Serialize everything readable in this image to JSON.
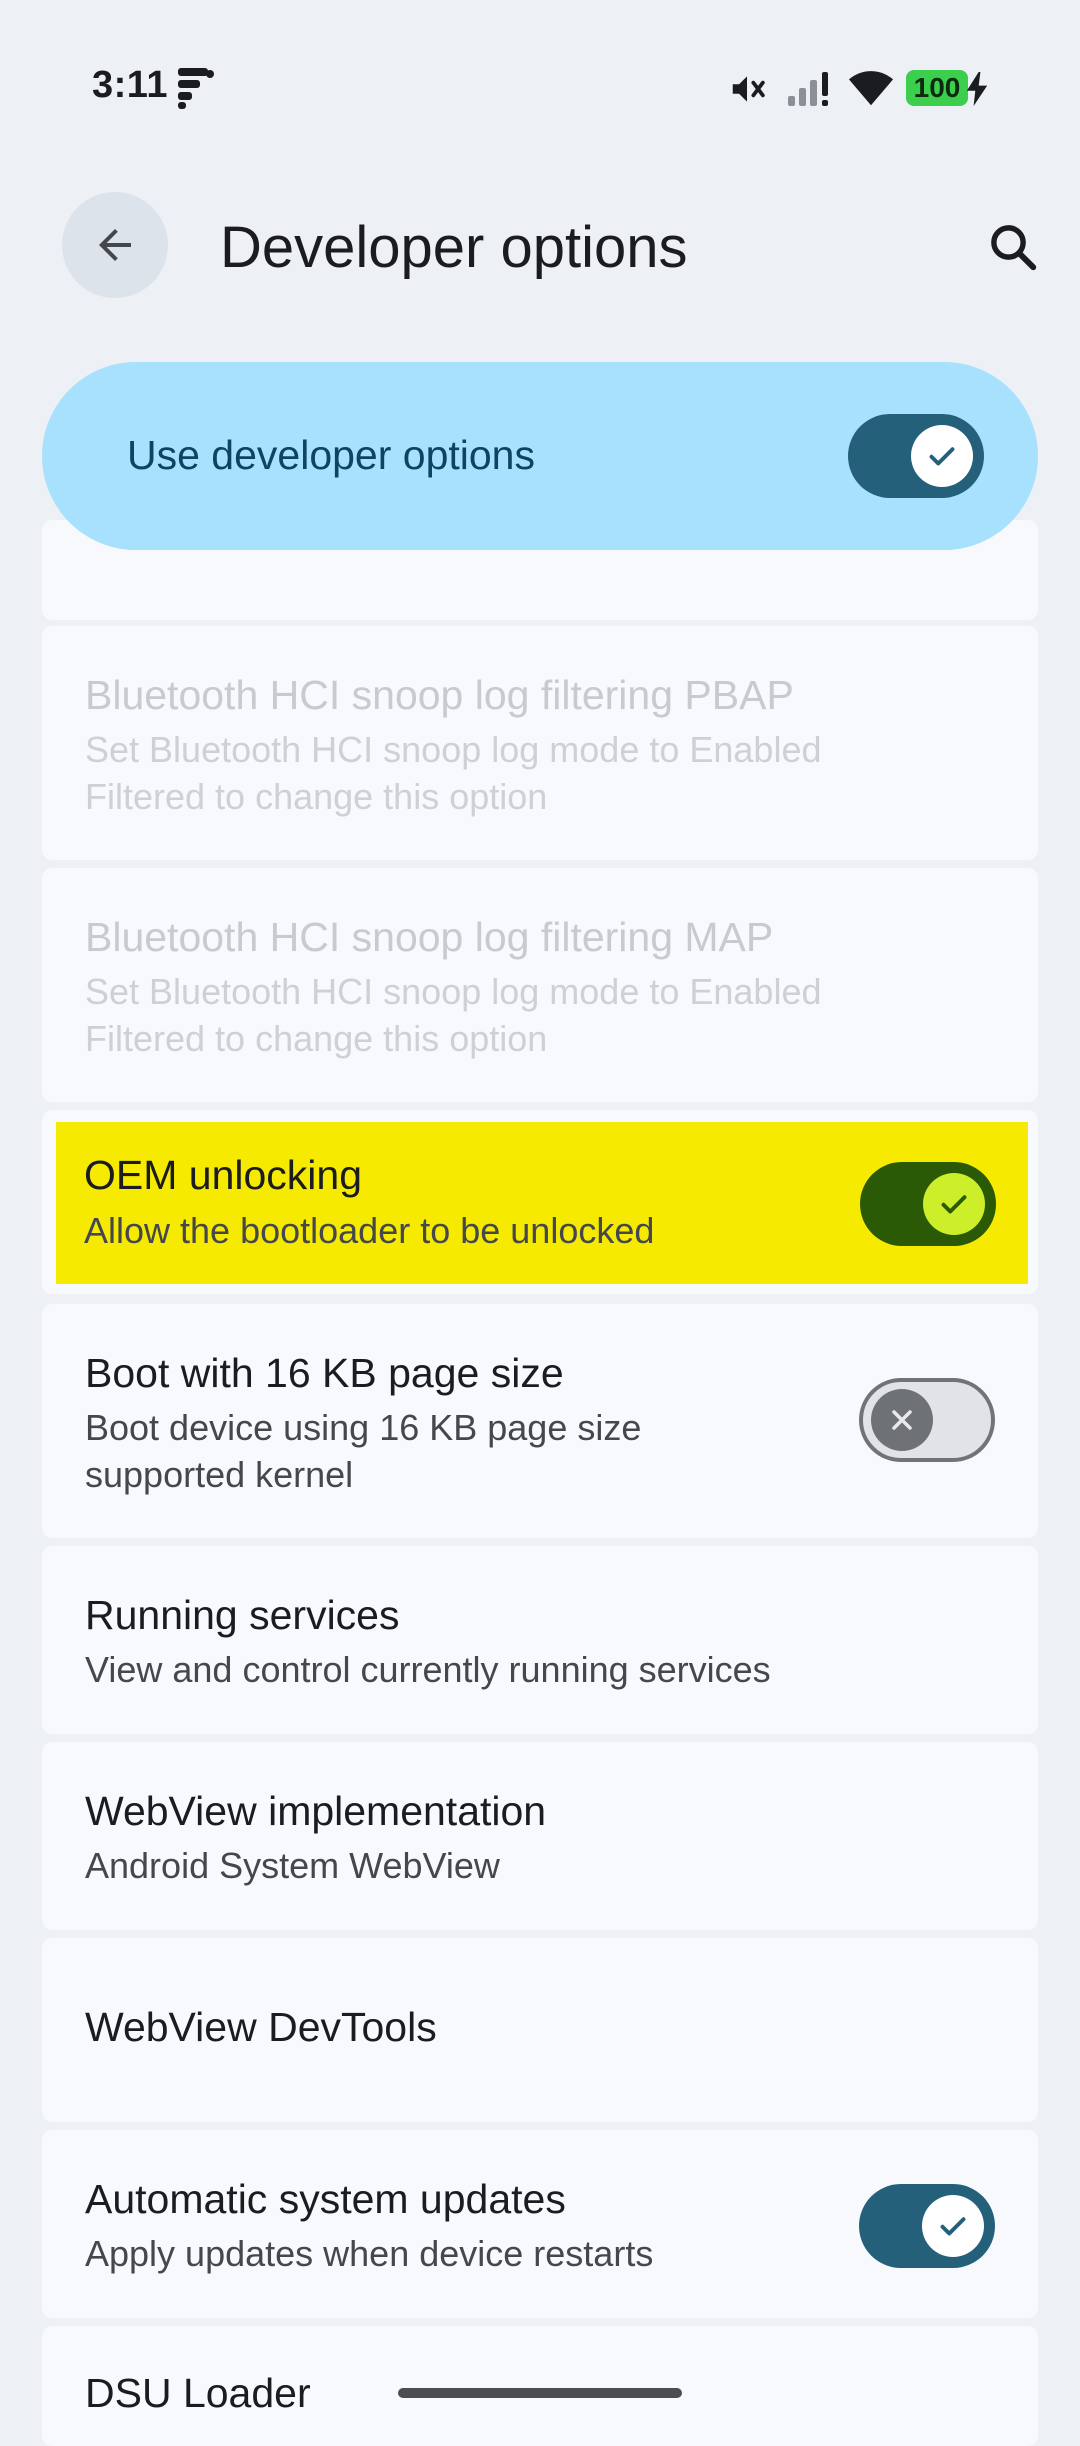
{
  "status_bar": {
    "time": "3:11",
    "battery": "100",
    "icons": [
      "notification-app-icon",
      "mute-icon",
      "signal-icon",
      "wifi-icon",
      "charging-bolt-icon"
    ]
  },
  "header": {
    "title": "Developer options",
    "back_icon": "arrow-back-icon",
    "search_icon": "search-icon"
  },
  "master": {
    "label": "Use developer options",
    "enabled": true
  },
  "settings": [
    {
      "title": "Bluetooth HCI snoop log filtering PBAP",
      "subtitle": "Set Bluetooth HCI snoop log mode to Enabled Filtered to change this option",
      "disabled": true
    },
    {
      "title": "Bluetooth HCI snoop log filtering MAP",
      "subtitle": "Set Bluetooth HCI snoop log mode to Enabled Filtered to change this option",
      "disabled": true
    },
    {
      "title": "OEM unlocking",
      "subtitle": "Allow the bootloader to be unlocked",
      "toggle": true,
      "highlighted": true
    },
    {
      "title": "Boot with 16 KB page size",
      "subtitle": "Boot device using 16 KB page size supported kernel",
      "toggle": false
    },
    {
      "title": "Running services",
      "subtitle": "View and control currently running services"
    },
    {
      "title": "WebView implementation",
      "subtitle": "Android System WebView"
    },
    {
      "title": "WebView DevTools",
      "subtitle": ""
    },
    {
      "title": "Automatic system updates",
      "subtitle": "Apply updates when device restarts",
      "toggle": true
    },
    {
      "title": "DSU Loader",
      "subtitle": ""
    }
  ],
  "colors": {
    "background": "#edf1f6",
    "master_card": "#a8e1fd",
    "switch_on": "#24607a",
    "highlight": "#f6ea00",
    "oem_switch": "#2b5a06"
  }
}
